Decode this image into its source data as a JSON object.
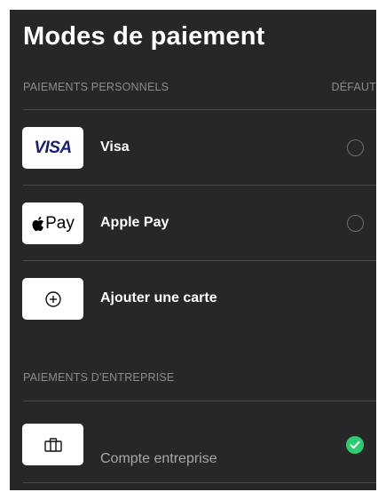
{
  "page": {
    "title": "Modes de paiement"
  },
  "personal": {
    "header": "PAIEMENTS PERSONNELS",
    "default_label": "DÉFAUT",
    "items": [
      {
        "logo_text": "VISA",
        "label": "Visa",
        "selected": false
      },
      {
        "logo_text": "Pay",
        "label": "Apple Pay",
        "selected": false
      }
    ],
    "add_card_label": "Ajouter une carte"
  },
  "business": {
    "header": "PAIEMENTS D'ENTREPRISE",
    "items": [
      {
        "sublabel": "Compte entreprise",
        "selected": true
      }
    ]
  },
  "icons": {
    "apple": "apple-icon",
    "add": "plus-circle-icon",
    "business": "briefcase-icon",
    "selected": "checkmark-icon"
  },
  "colors": {
    "background": "#272727",
    "selected": "#2ecc71",
    "visa_blue": "#1a1f71"
  }
}
